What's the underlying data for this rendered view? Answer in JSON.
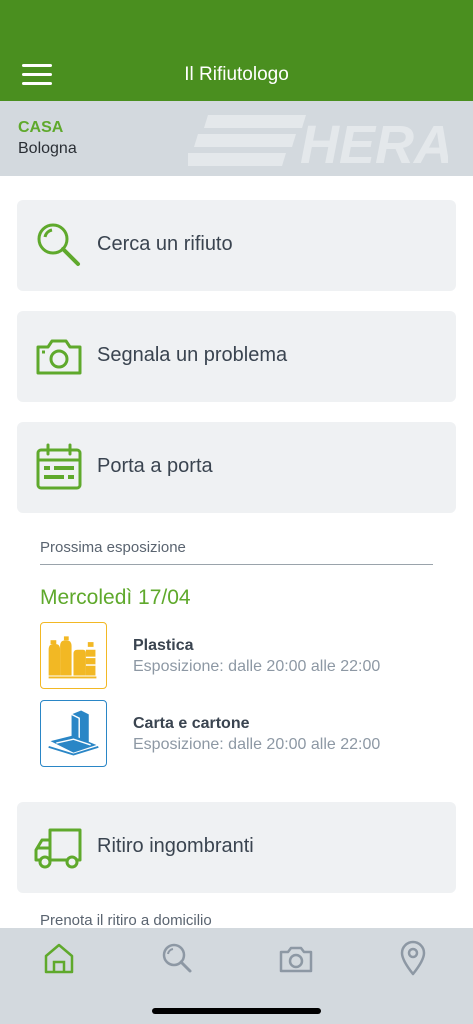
{
  "header": {
    "title": "Il Rifiutologo"
  },
  "location": {
    "type": "CASA",
    "city": "Bologna",
    "logo_text": "HERA"
  },
  "menu": {
    "search_label": "Cerca un rifiuto",
    "report_label": "Segnala un problema",
    "door_label": "Porta a porta",
    "bulky_label": "Ritiro ingombranti"
  },
  "schedule": {
    "section_title": "Prossima esposizione",
    "date": "Mercoledì 17/04",
    "items": [
      {
        "name": "Plastica",
        "time": "Esposizione: dalle 20:00 alle 22:00",
        "icon": "plastic-bottles-icon"
      },
      {
        "name": "Carta e cartone",
        "time": "Esposizione: dalle 20:00 alle 22:00",
        "icon": "paper-cardboard-icon"
      }
    ]
  },
  "bulky": {
    "subtitle": "Prenota il ritiro a domicilio"
  },
  "tabs": [
    "home-icon",
    "search-icon",
    "camera-icon",
    "location-pin-icon"
  ],
  "colors": {
    "header": "#4a8f1f",
    "accent": "#5fa92c",
    "plastic": "#f2b824",
    "paper": "#2a86c6"
  }
}
